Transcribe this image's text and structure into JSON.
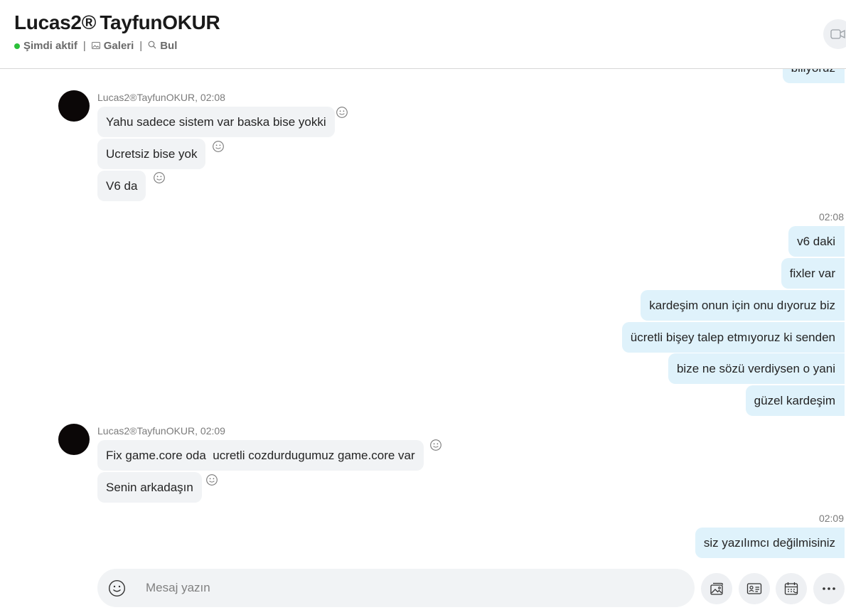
{
  "header": {
    "title": "Lucas2® TayfunOKUR",
    "status": "Şimdi aktif",
    "separator": "|",
    "gallery": "Galeri",
    "find": "Bul"
  },
  "messages": {
    "partial_top": "biliyoruz",
    "group1": {
      "sender": "Lucas2®TayfunOKUR, 02:08",
      "items": [
        "Yahu sadece sistem var baska bise yokki",
        "Ucretsiz bise yok",
        "V6 da"
      ]
    },
    "group2": {
      "time": "02:08",
      "items": [
        "v6 daki",
        "fixler var",
        "kardeşim onun için onu dıyoruz biz",
        "ücretli bişey talep etmıyoruz ki senden",
        "bize ne sözü verdiysen o yani",
        "güzel kardeşim"
      ]
    },
    "group3": {
      "sender": "Lucas2®TayfunOKUR, 02:09",
      "items": [
        "Fix game.core oda  ucretli cozdurdugumuz game.core var",
        "Senin arkadaşın"
      ]
    },
    "group4": {
      "time": "02:09",
      "items": [
        "siz yazılımcı değilmisiniz"
      ]
    }
  },
  "composer": {
    "placeholder": "Mesaj yazın"
  },
  "colors": {
    "online": "#2bc03a",
    "incoming_bubble": "#f1f3f5",
    "outgoing_bubble": "#dff2fb"
  },
  "icons": [
    "video-call-icon",
    "gallery-icon",
    "search-icon",
    "smiley-icon",
    "media-icon",
    "contact-card-icon",
    "calendar-icon",
    "more-icon"
  ]
}
